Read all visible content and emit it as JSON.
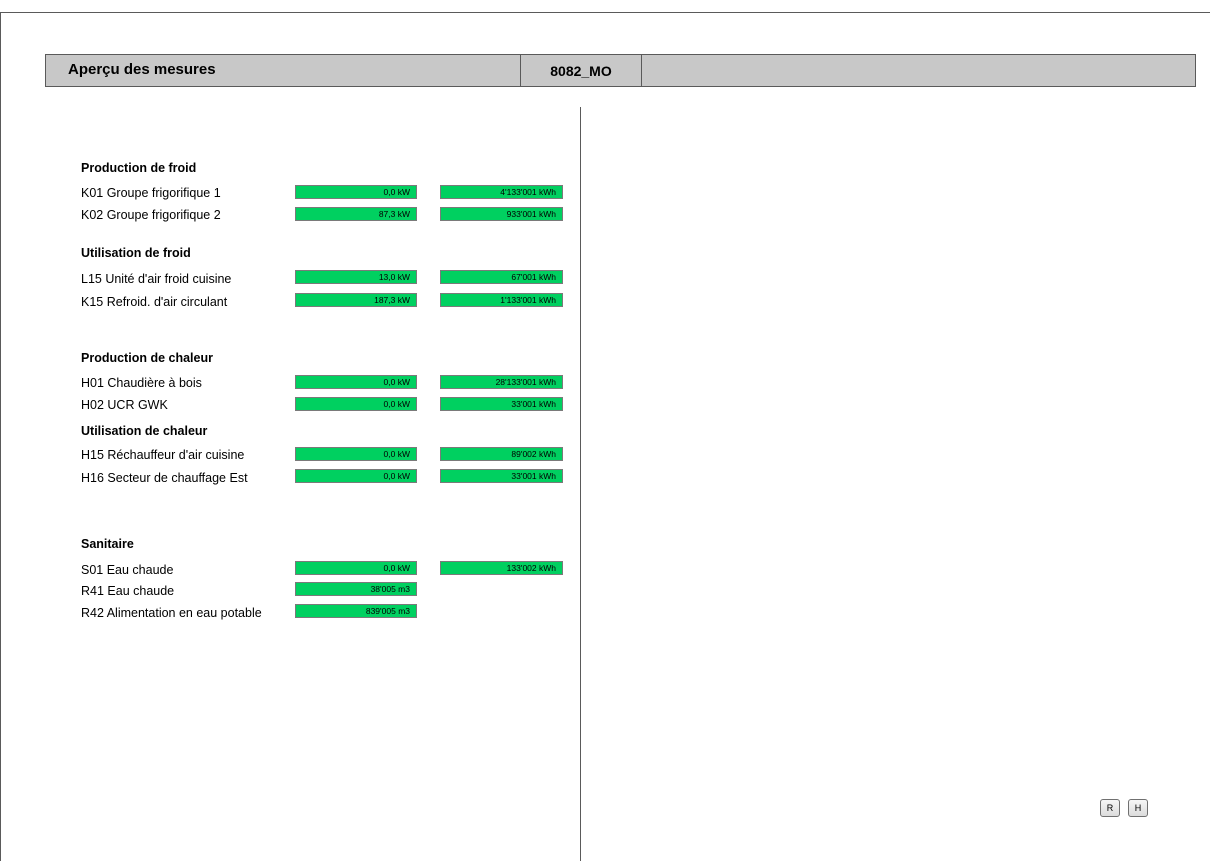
{
  "header": {
    "title": "Aperçu des mesures",
    "code": "8082_MO",
    "right_text": ""
  },
  "sections": [
    {
      "title": "Production de froid",
      "rows": [
        {
          "label": "K01 Groupe frigorifique 1",
          "power": "0,0 kW",
          "energy": "4'133'001 kWh"
        },
        {
          "label": "K02 Groupe frigorifique 2",
          "power": "87,3 kW",
          "energy": "933'001 kWh"
        }
      ]
    },
    {
      "title": "Utilisation de froid",
      "rows": [
        {
          "label": "L15 Unité d'air froid cuisine",
          "power": "13,0 kW",
          "energy": "67'001 kWh"
        },
        {
          "label": "K15 Refroid. d'air circulant",
          "power": "187,3 kW",
          "energy": "1'133'001 kWh"
        }
      ]
    },
    {
      "title": "Production de chaleur",
      "rows": [
        {
          "label": "H01 Chaudière à bois",
          "power": "0,0 kW",
          "energy": "28'133'001 kWh"
        },
        {
          "label": "H02 UCR GWK",
          "power": "0,0 kW",
          "energy": "33'001 kWh"
        }
      ]
    },
    {
      "title": "Utilisation de chaleur",
      "rows": [
        {
          "label": "H15 Réchauffeur d'air cuisine",
          "power": "0,0 kW",
          "energy": "89'002 kWh"
        },
        {
          "label": "H16 Secteur de chauffage Est",
          "power": "0,0 kW",
          "energy": "33'001 kWh"
        }
      ]
    },
    {
      "title": "Sanitaire",
      "rows": [
        {
          "label": "S01 Eau chaude",
          "power": "0,0 kW",
          "energy": "133'002 kWh"
        },
        {
          "label": "R41 Eau chaude",
          "power": "38'005 m3"
        },
        {
          "label": "R42 Alimentation en eau potable",
          "power": "839'005 m3"
        }
      ]
    }
  ],
  "buttons": {
    "r_label": "R",
    "h_label": "H"
  },
  "colors": {
    "value_green": "#00d060",
    "header_gray": "#c8c8c8"
  }
}
